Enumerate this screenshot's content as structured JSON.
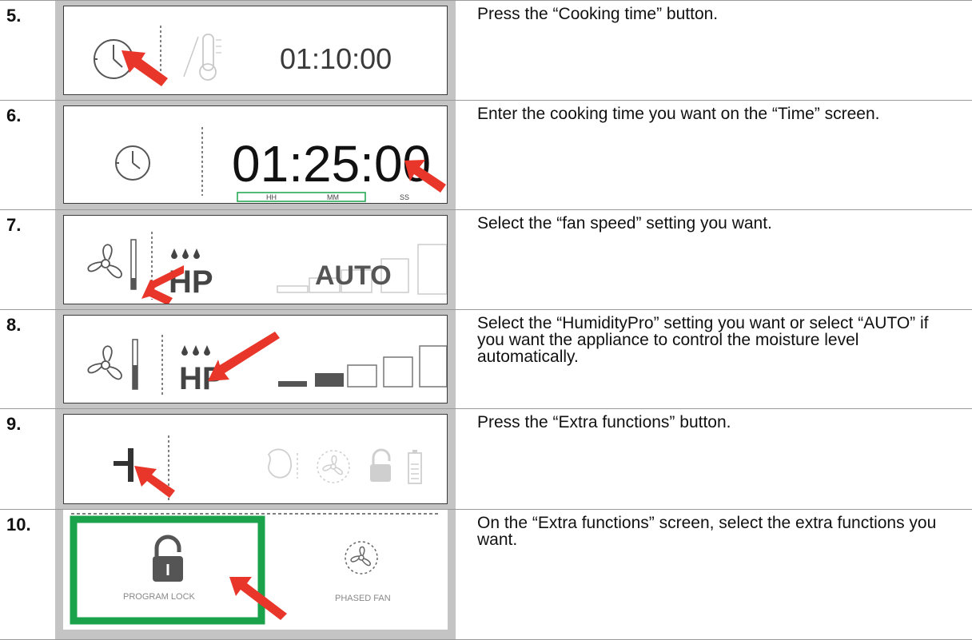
{
  "steps": [
    {
      "number": "5.",
      "text": "Press the “Cooking time” button.",
      "screen": {
        "value": "01:10:00"
      }
    },
    {
      "number": "6.",
      "text": "Enter the cooking time you want on the “Time” screen.",
      "screen": {
        "value": "01:25:00",
        "labels": [
          "HH",
          "MM",
          "SS"
        ]
      }
    },
    {
      "number": "7.",
      "text": "Select the “fan speed” setting you want.",
      "screen": {
        "hp_label": "HP",
        "auto_label": "AUTO"
      }
    },
    {
      "number": "8.",
      "text": "Select the “HumidityPro” setting you want or select “AUTO” if you want the appliance to control the moisture level automatically.",
      "screen": {
        "hp_label": "HP"
      }
    },
    {
      "number": "9.",
      "text": "Press the “Extra functions” button.",
      "screen": {}
    },
    {
      "number": "10.",
      "text": "On the “Extra functions” screen, select the extra functions you want.",
      "screen": {
        "left_label": "PROGRAM LOCK",
        "right_label": "PHASED FAN"
      }
    }
  ],
  "colors": {
    "arrow": "#e8362a",
    "highlight": "#1aa34a",
    "panel_bg": "#c4c4c4",
    "icon_grey": "#555555"
  }
}
